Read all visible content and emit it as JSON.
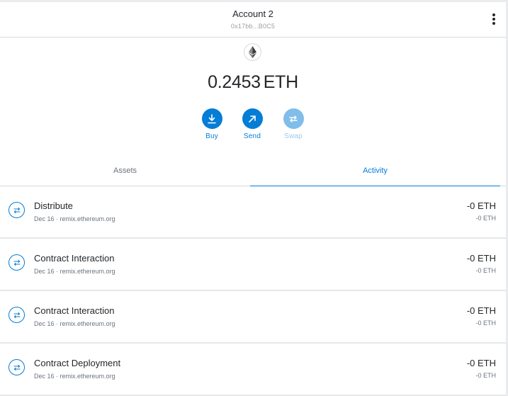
{
  "header": {
    "account_name": "Account 2",
    "account_address": "0x17bb...B0C5",
    "menu_icon": "kebab-menu-icon"
  },
  "balance": {
    "logo_icon": "ethereum-icon",
    "amount": "0.2453",
    "unit": "ETH"
  },
  "actions": [
    {
      "label": "Buy",
      "icon": "download-icon",
      "enabled": true
    },
    {
      "label": "Send",
      "icon": "arrow-up-right-icon",
      "enabled": true
    },
    {
      "label": "Swap",
      "icon": "swap-icon",
      "enabled": false
    }
  ],
  "tabs": [
    {
      "label": "Assets",
      "active": false
    },
    {
      "label": "Activity",
      "active": true
    }
  ],
  "activity": [
    {
      "title": "Distribute",
      "subtitle": "Dec 16 · remix.ethereum.org",
      "amount": "-0 ETH",
      "secondary_amount": "-0 ETH",
      "icon": "interaction-icon"
    },
    {
      "title": "Contract Interaction",
      "subtitle": "Dec 16 · remix.ethereum.org",
      "amount": "-0 ETH",
      "secondary_amount": "-0 ETH",
      "icon": "interaction-icon"
    },
    {
      "title": "Contract Interaction",
      "subtitle": "Dec 16 · remix.ethereum.org",
      "amount": "-0 ETH",
      "secondary_amount": "-0 ETH",
      "icon": "interaction-icon"
    },
    {
      "title": "Contract Deployment",
      "subtitle": "Dec 16 · remix.ethereum.org",
      "amount": "-0 ETH",
      "secondary_amount": "-0 ETH",
      "icon": "interaction-icon"
    }
  ],
  "colors": {
    "accent": "#037dd6",
    "accent_disabled": "#80bdea",
    "text": "#24272a",
    "muted": "#6a737d",
    "divider": "#d6d9dc"
  }
}
